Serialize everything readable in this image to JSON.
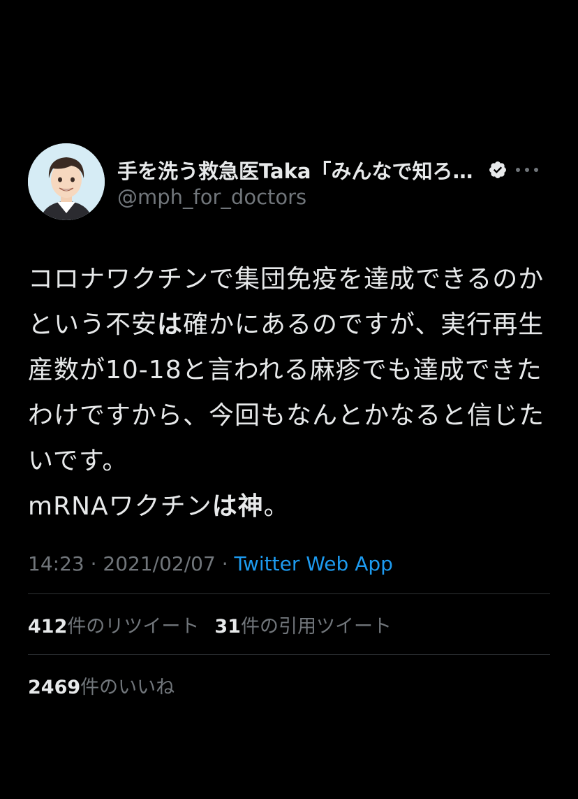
{
  "tweet": {
    "author": {
      "display_name": "手を洗う救急医Taka「みんなで知ろ…",
      "handle": "@mph_for_doctors",
      "verified": true
    },
    "body": {
      "part1": "コロナワクチンで集団免疫を達成できるのかという不安",
      "bold1": "は",
      "part2": "確かにあるのですが、実行再生産数が10-18と言われる麻疹でも達成できたわけですから、今回もなんとかなると信じたいです。\nmRNAワクチン",
      "bold2": "は神",
      "part3": "。"
    },
    "meta": {
      "time": "14:23",
      "sep1": " · ",
      "date": "2021/02/07",
      "sep2": " · ",
      "source": "Twitter Web App"
    },
    "stats": {
      "retweets_count": "412",
      "retweets_label": "件のリツイート",
      "quotes_count": "31",
      "quotes_label": "件の引用ツイート",
      "likes_count": "2469",
      "likes_label": "件のいいね"
    }
  },
  "icons": {
    "verified": "verified-badge-icon",
    "more": "more-horizontal-icon"
  },
  "colors": {
    "background": "#000000",
    "text_primary": "#e7e9ea",
    "text_secondary": "#71767b",
    "link": "#1d9bf0",
    "divider": "#2f3336"
  }
}
